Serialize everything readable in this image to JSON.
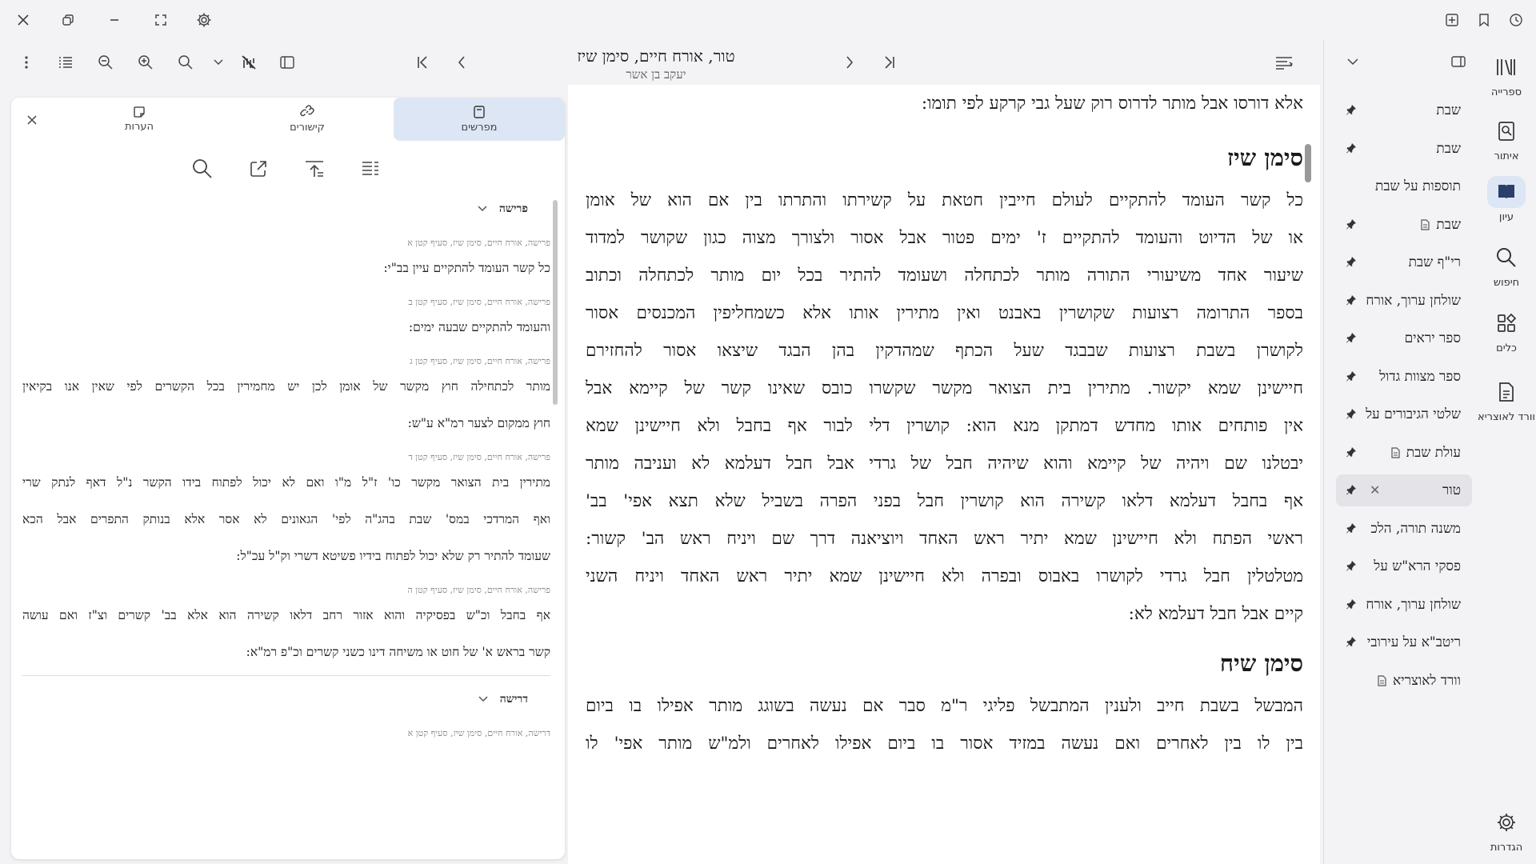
{
  "book": {
    "title": "טור, אורח חיים, סימן שיז",
    "author": "יעקב בן אשר"
  },
  "main_text": {
    "lines_before": [
      "אלא דורסו אבל מותר לדרוס רוק שעל גבי קרקע לפי תומו:"
    ],
    "sections": [
      {
        "heading": "סימן שיז",
        "lines": [
          "כל קשר העומד להתקיים לעולם חייבין חטאת על קשירתו והתרתו בין אם הוא של אומן",
          "או של הדיוט והעומד להתקיים ז' ימים פטור אבל אסור ולצורך מצוה כגון שקושר למדוד",
          "שיעור אחד משיעורי התורה מותר לכתחלה ושעומד להתיר בכל יום מותר לכתחלה וכתוב",
          "בספר התרומה רצועות שקושרין באבנט ואין מתירין אותו אלא כשמחליפין המכנסים אסור",
          "לקושרן בשבת רצועות שבבגד שעל הכתף שמהדקין בהן הבגד שיצאו אסור להחזירם",
          "חיישינן שמא יקשור. מתירין בית הצואר מקשר שקשרו כובס שאינו קשר של קיימא אבל",
          "אין פותחים אותו מחדש דמתקן מנא הוא: קושרין דלי לבור אף בחבל ולא חיישינן שמא",
          "יבטלנו שם ויהיה של קיימא והוא שיהיה חבל של גרדי אבל חבל דעלמא לא ועניבה מותר",
          "אף בחבל דעלמא דלאו קשירה הוא קושרין חבל בפני הפרה בשביל שלא תצא אפי' בב'",
          "ראשי הפתח ולא חיישינן שמא יתיר ראש האחד ויוציאנה דרך שם ויניח ראש הב' קשור:",
          "מטלטלין חבל גרדי לקושרו באבוס ובפרה ולא חיישינן שמא יתיר ראש האחד ויניח השני",
          "קיים אבל חבל דעלמא לא:"
        ]
      },
      {
        "heading": "סימן שיח",
        "lines": [
          "המבשל בשבת חייב ולענין המתבשל פליגי ר\"מ סבר אם נעשה בשוגג מותר אפילו בו ביום",
          "בין לו בין לאחרים ואם נעשה במזיד אסור בו ביום אפילו לאחרים ולמ\"ש מותר אפי' לו"
        ]
      }
    ]
  },
  "panel": {
    "tabs": [
      {
        "label": "מפרשים",
        "icon": "book-icon",
        "active": true
      },
      {
        "label": "קישורים",
        "icon": "link-icon",
        "active": false
      },
      {
        "label": "הערות",
        "icon": "note-icon",
        "active": false
      }
    ],
    "groups": [
      {
        "name": "פרישה",
        "items": [
          {
            "source": "פרישה, אורח חיים, סימן שיז, סעיף קטן א",
            "lines": [
              "כל קשר העומד להתקיים עיין בב\"י:"
            ]
          },
          {
            "source": "פרישה, אורח חיים, סימן שיז, סעיף קטן ב",
            "lines": [
              "והעומד להתקיים שבעה ימים:"
            ]
          },
          {
            "source": "פרישה, אורח חיים, סימן שיז, סעיף קטן ג",
            "lines": [
              "מותר לכתחילה חוץ מקשר של אומן לכן יש מחמירין בכל הקשרים לפי שאין אנו בקיאין",
              "חוץ ממקום לצער רמ\"א ע\"ש:"
            ]
          },
          {
            "source": "פרישה, אורח חיים, סימן שיז, סעיף קטן ד",
            "lines": [
              "מתירין בית הצואר מקשר כו' ז\"ל מ\"ו ואם לא יכול לפתוח בידו הקשר נ\"ל דאף לנתק שרי",
              "ואף המרדכי במס' שבת בהג\"ה לפי' הגאונים לא אסר אלא בנותק התפרים אבל הכא",
              "שעומד להתיר רק שלא יכול לפתוח בידיו פשיטא דשרי וק\"ל עכ\"ל:"
            ]
          },
          {
            "source": "פרישה, אורח חיים, סימן שיז, סעיף קטן ה",
            "lines": [
              "אף בחבל וכ\"ש בפסיקיה והוא אזור רחב דלאו קשירה הוא אלא בב' קשרים וצ\"ז ואם עושה",
              "קשר בראש א' של חוט או משיחה דינו כשני קשרים וכ\"פ רמ\"א:"
            ]
          }
        ]
      },
      {
        "name": "דרישה",
        "items": [
          {
            "source": "דרישה, אורח חיים, סימן שיז, סעיף קטן א",
            "lines": []
          }
        ]
      }
    ]
  },
  "bookmarks": [
    {
      "label": "שבת",
      "pinned": true,
      "doc": false,
      "closable": false,
      "active": false
    },
    {
      "label": "שבת",
      "pinned": true,
      "doc": false,
      "closable": false,
      "active": false
    },
    {
      "label": "תוספות על שבת",
      "pinned": false,
      "doc": false,
      "closable": false,
      "active": false
    },
    {
      "label": "שבת",
      "pinned": true,
      "doc": true,
      "closable": false,
      "active": false
    },
    {
      "label": "רי\"ף שבת",
      "pinned": true,
      "doc": false,
      "closable": false,
      "active": false
    },
    {
      "label": "שולחן ערוך, אורח",
      "pinned": true,
      "doc": false,
      "closable": false,
      "active": false
    },
    {
      "label": "ספר יראים",
      "pinned": true,
      "doc": false,
      "closable": false,
      "active": false
    },
    {
      "label": "ספר מצוות גדול",
      "pinned": true,
      "doc": false,
      "closable": false,
      "active": false
    },
    {
      "label": "שלטי הגיבורים על",
      "pinned": true,
      "doc": false,
      "closable": false,
      "active": false
    },
    {
      "label": "עולת שבת",
      "pinned": true,
      "doc": true,
      "closable": false,
      "active": false
    },
    {
      "label": "טור",
      "pinned": true,
      "doc": false,
      "closable": true,
      "active": true
    },
    {
      "label": "משנה תורה, הלכ",
      "pinned": true,
      "doc": false,
      "closable": false,
      "active": false
    },
    {
      "label": "פסקי הרא\"ש על",
      "pinned": true,
      "doc": false,
      "closable": false,
      "active": false
    },
    {
      "label": "שולחן ערוך, אורח",
      "pinned": true,
      "doc": false,
      "closable": false,
      "active": false
    },
    {
      "label": "ריטב\"א על עירובי",
      "pinned": true,
      "doc": false,
      "closable": false,
      "active": false
    },
    {
      "label": "וורד לאוצריא",
      "pinned": false,
      "doc": true,
      "closable": false,
      "active": false
    }
  ],
  "nav": [
    {
      "label": "ספרייה",
      "icon": "library-icon",
      "active": false
    },
    {
      "label": "איתור",
      "icon": "locate-icon",
      "active": false
    },
    {
      "label": "עיון",
      "icon": "open-book-icon",
      "active": true
    },
    {
      "label": "חיפוש",
      "icon": "search-icon",
      "active": false
    },
    {
      "label": "כלים",
      "icon": "tools-icon",
      "active": false
    },
    {
      "label": "וורד לאוצריא",
      "icon": "document-icon",
      "active": false
    },
    {
      "label": "הגדרות",
      "icon": "settings-icon",
      "active": false
    }
  ],
  "colors": {
    "accent": "#dde6f5",
    "background": "#f3f3f5",
    "text": "#1a1a1a"
  }
}
